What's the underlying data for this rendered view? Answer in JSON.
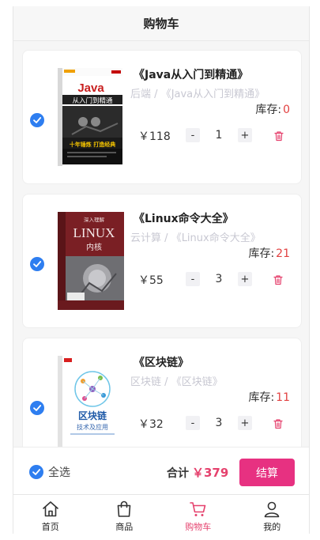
{
  "header": {
    "title": "购物车"
  },
  "cart": {
    "items": [
      {
        "title": "《Java从入门到精通》",
        "category": "后端",
        "crumb_title": "《Java从入门到精通》",
        "separator": "/",
        "stock_label": "库存:",
        "stock": "0",
        "price": "￥118",
        "qty": "1",
        "minus": "-",
        "plus": "+",
        "cover": {
          "line1": "Java",
          "line2": "从入门到精通",
          "line3": "十年锤炼 打造经典"
        }
      },
      {
        "title": "《Linux命令大全》",
        "category": "云计算",
        "crumb_title": "《Linux命令大全》",
        "separator": "/",
        "stock_label": "库存:",
        "stock": "21",
        "price": "￥55",
        "qty": "3",
        "minus": "-",
        "plus": "+",
        "cover": {
          "line1": "LINUX",
          "line2": "内核",
          "line3": "深入理解"
        }
      },
      {
        "title": "《区块链》",
        "category": "区块链",
        "crumb_title": "《区块链》",
        "separator": "/",
        "stock_label": "库存:",
        "stock": "11",
        "price": "￥32",
        "qty": "3",
        "minus": "-",
        "plus": "+",
        "cover": {
          "line1": "区块链",
          "line2": "技术及应用"
        }
      }
    ]
  },
  "footer": {
    "select_all": "全选",
    "total_label": "合计",
    "total_value": "￥379",
    "checkout": "结算"
  },
  "tabbar": {
    "tabs": [
      {
        "label": "首页",
        "icon": "home-icon"
      },
      {
        "label": "商品",
        "icon": "bag-icon"
      },
      {
        "label": "购物车",
        "icon": "cart-icon",
        "active": true
      },
      {
        "label": "我的",
        "icon": "user-icon"
      }
    ]
  },
  "colors": {
    "accent": "#e73181",
    "check": "#2e7ef0",
    "stock_red": "#e24040",
    "crumb": "#c8c8d2"
  }
}
